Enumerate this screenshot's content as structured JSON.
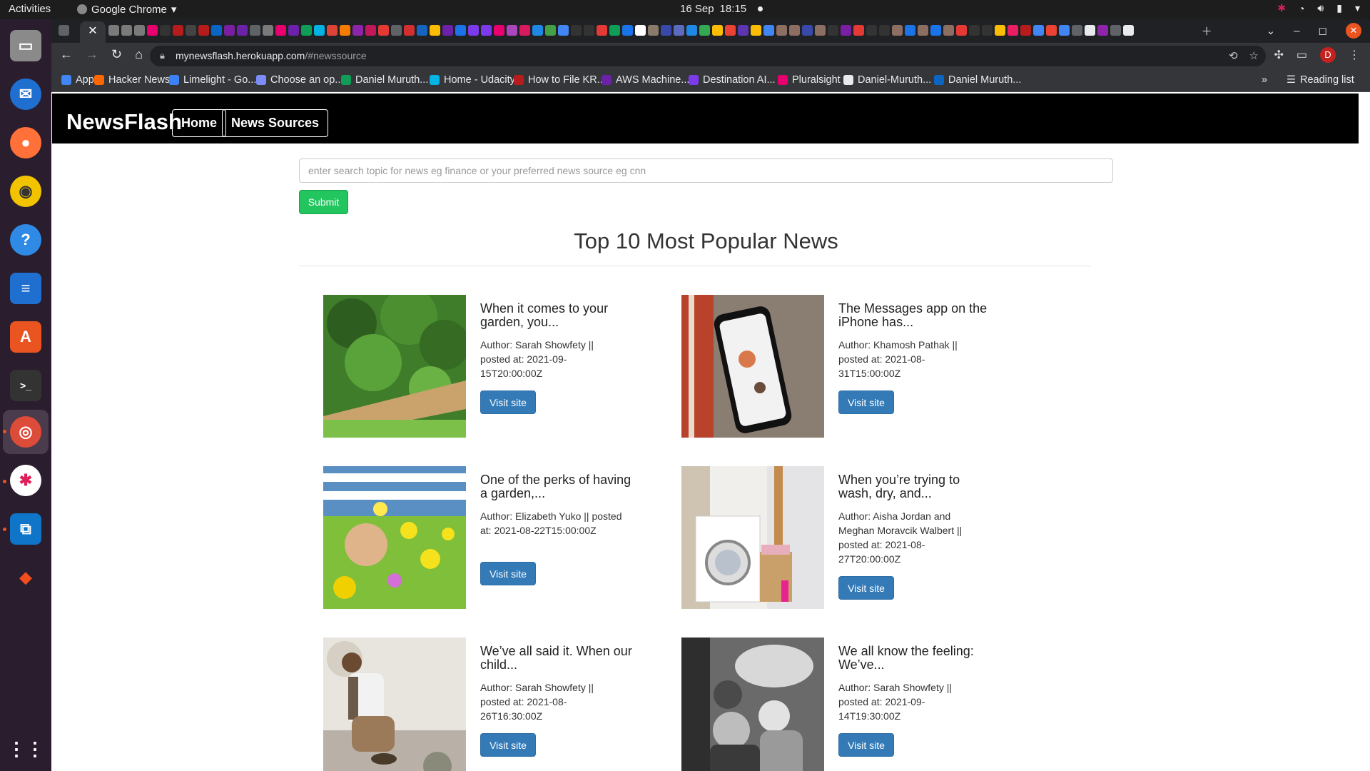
{
  "system_bar": {
    "activities": "Activities",
    "app_name": "Google Chrome",
    "date": "16 Sep",
    "time": "18:15"
  },
  "browser": {
    "url_host": "mynewsflash.herokuapp.com",
    "url_path": "/#newssource",
    "profile_initial": "D",
    "bookmarks": [
      {
        "label": "Apps",
        "color": "#4285f4"
      },
      {
        "label": "Hacker News",
        "color": "#ff6600"
      },
      {
        "label": "Limelight - Go...",
        "color": "#3b82f6"
      },
      {
        "label": "Choose an op...",
        "color": "#7c8cf8"
      },
      {
        "label": "Daniel Muruth...",
        "color": "#0f9d58"
      },
      {
        "label": "Home - Udacity",
        "color": "#02b3e4"
      },
      {
        "label": "How to File KR...",
        "color": "#b71c1c"
      },
      {
        "label": "AWS Machine...",
        "color": "#6b21a8"
      },
      {
        "label": "Destination AI...",
        "color": "#7c3aed"
      },
      {
        "label": "Pluralsight",
        "color": "#e8006f"
      },
      {
        "label": "Daniel-Muruth...",
        "color": "#e8eaed"
      },
      {
        "label": "Daniel Muruth...",
        "color": "#0a66c2"
      }
    ],
    "bookmarks_overflow": "»",
    "reading_list": "Reading list"
  },
  "page": {
    "brand": "NewsFlash",
    "nav": [
      "Home",
      "News Sources"
    ],
    "search_placeholder": "enter search topic for news eg finance or your preferred news source eg cnn",
    "submit_label": "Submit",
    "heading": "Top 10 Most Popular News",
    "visit_label": "Visit site",
    "articles": [
      {
        "title": "When it comes to your garden, you...",
        "meta": "Author: Sarah Showfety || posted at: 2021-09-15T20:00:00Z",
        "image": "garden-beds"
      },
      {
        "title": "The Messages app on the iPhone has...",
        "meta": "Author: Khamosh Pathak || posted at: 2021-08-31T15:00:00Z",
        "image": "iphone-messages"
      },
      {
        "title": "One of the perks of having a garden,...",
        "meta": "Author: Elizabeth Yuko || posted at: 2021-08-22T15:00:00Z",
        "image": "wildflowers"
      },
      {
        "title": "When you’re trying to wash, dry, and...",
        "meta": "Author: Aisha Jordan and Meghan Moravcik Walbert || posted at: 2021-08-27T20:00:00Z",
        "image": "washing-machine"
      },
      {
        "title": "We’ve all said it. When our child...",
        "meta": "Author: Sarah Showfety || posted at: 2021-08-26T16:30:00Z",
        "image": "child-shoes"
      },
      {
        "title": "We all know the feeling: We’ve...",
        "meta": "Author: Sarah Showfety || posted at: 2021-09-14T19:30:00Z",
        "image": "car-backseat"
      }
    ]
  }
}
